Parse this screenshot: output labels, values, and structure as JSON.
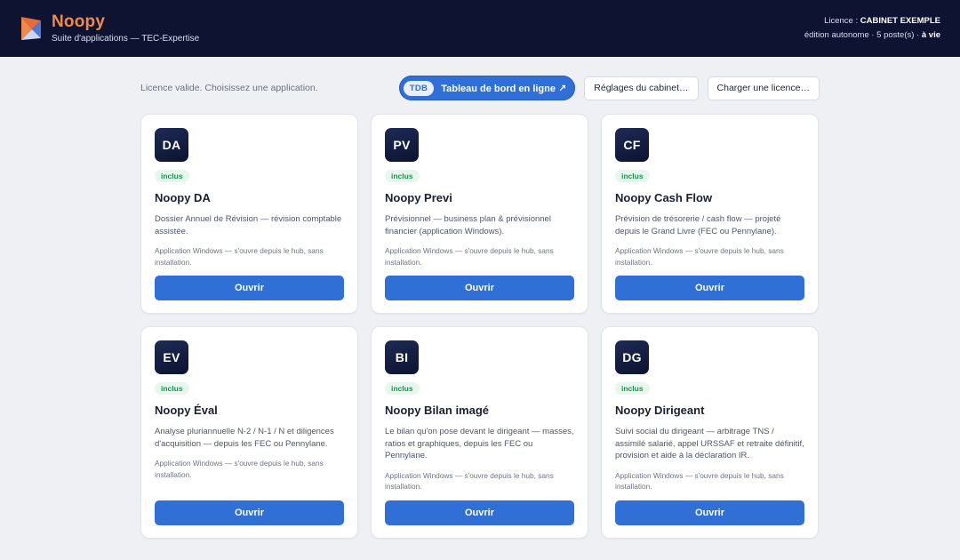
{
  "header": {
    "app_name": "Noopy",
    "subtitle": "Suite d'applications — TEC-Expertise",
    "license_label": "Licence : ",
    "license_holder": "CABINET EXEMPLE",
    "edition_text": "édition autonome · 5 poste(s) · ",
    "validity": "à vie"
  },
  "toolbar": {
    "status": "Licence valide. Choisissez une application.",
    "dashboard_badge": "TDB",
    "dashboard_label": "Tableau de bord en ligne ↗",
    "settings_label": "Réglages du cabinet…",
    "load_license_label": "Charger une licence…"
  },
  "colors": {
    "header_bg": "#0d1330",
    "brand_accent": "#f08a4b",
    "primary": "#2f6fd6",
    "badge_green": "#15934f"
  },
  "apps": [
    {
      "code": "DA",
      "badge": "inclus",
      "name": "Noopy DA",
      "description": "Dossier Annuel de Révision — révision comptable assistée.",
      "note": "Application Windows — s'ouvre depuis le hub, sans installation.",
      "button": "Ouvrir"
    },
    {
      "code": "PV",
      "badge": "inclus",
      "name": "Noopy Previ",
      "description": "Prévisionnel — business plan & prévisionnel financier (application Windows).",
      "note": "Application Windows — s'ouvre depuis le hub, sans installation.",
      "button": "Ouvrir"
    },
    {
      "code": "CF",
      "badge": "inclus",
      "name": "Noopy Cash Flow",
      "description": "Prévision de trésorerie / cash flow — projeté depuis le Grand Livre (FEC ou Pennylane).",
      "note": "Application Windows — s'ouvre depuis le hub, sans installation.",
      "button": "Ouvrir"
    },
    {
      "code": "EV",
      "badge": "inclus",
      "name": "Noopy Éval",
      "description": "Analyse pluriannuelle N-2 / N-1 / N et diligences d'acquisition — depuis les FEC ou Pennylane.",
      "note": "Application Windows — s'ouvre depuis le hub, sans installation.",
      "button": "Ouvrir"
    },
    {
      "code": "BI",
      "badge": "inclus",
      "name": "Noopy Bilan imagé",
      "description": "Le bilan qu'on pose devant le dirigeant — masses, ratios et graphiques, depuis les FEC ou Pennylane.",
      "note": "Application Windows — s'ouvre depuis le hub, sans installation.",
      "button": "Ouvrir"
    },
    {
      "code": "DG",
      "badge": "inclus",
      "name": "Noopy Dirigeant",
      "description": "Suivi social du dirigeant — arbitrage TNS / assimilé salarié, appel URSSAF et retraite définitif, provision et aide à la déclaration IR.",
      "note": "Application Windows — s'ouvre depuis le hub, sans installation.",
      "button": "Ouvrir"
    }
  ]
}
